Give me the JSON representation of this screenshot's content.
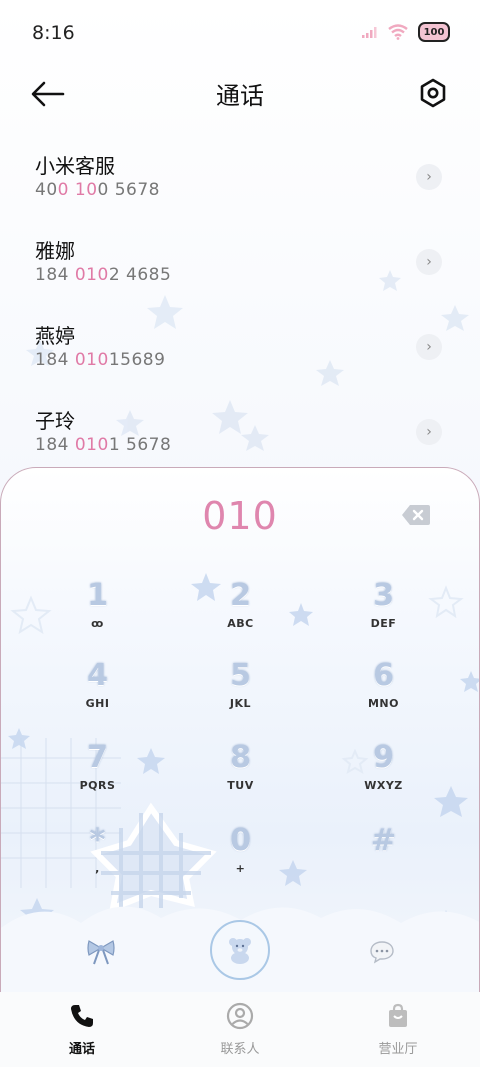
{
  "status_bar": {
    "time": "8:16",
    "battery": "100"
  },
  "app_bar": {
    "title": "通话"
  },
  "contacts": [
    {
      "name": "小米客服",
      "number_parts": [
        "40",
        "0",
        " ",
        "10",
        "0 5678"
      ]
    },
    {
      "name": "雅娜",
      "number_parts": [
        "184 ",
        "010",
        "2 4685",
        "",
        ""
      ]
    },
    {
      "name": "燕婷",
      "number_parts": [
        "184 ",
        "010",
        "15689",
        "",
        ""
      ]
    },
    {
      "name": "子玲",
      "number_parts": [
        "184 ",
        "010",
        "1 5678",
        "",
        ""
      ]
    }
  ],
  "dialer": {
    "input": "010",
    "keys": [
      {
        "digit": "1",
        "letters": "ꝏ"
      },
      {
        "digit": "2",
        "letters": "ABC"
      },
      {
        "digit": "3",
        "letters": "DEF"
      },
      {
        "digit": "4",
        "letters": "GHI"
      },
      {
        "digit": "5",
        "letters": "JKL"
      },
      {
        "digit": "6",
        "letters": "MNO"
      },
      {
        "digit": "7",
        "letters": "PQRS"
      },
      {
        "digit": "8",
        "letters": "TUV"
      },
      {
        "digit": "9",
        "letters": "WXYZ"
      },
      {
        "digit": "*",
        "letters": ","
      },
      {
        "digit": "0",
        "letters": "+"
      },
      {
        "digit": "#",
        "letters": ""
      }
    ]
  },
  "tabs": [
    {
      "label": "通话",
      "icon": "phone-icon",
      "active": true
    },
    {
      "label": "联系人",
      "icon": "contact-icon",
      "active": false
    },
    {
      "label": "营业厅",
      "icon": "shopping-bag-icon",
      "active": false
    }
  ],
  "colors": {
    "highlight": "#e07aa6",
    "dial_digits": "#b8c9e2",
    "accent_blue": "#aac8e6"
  }
}
